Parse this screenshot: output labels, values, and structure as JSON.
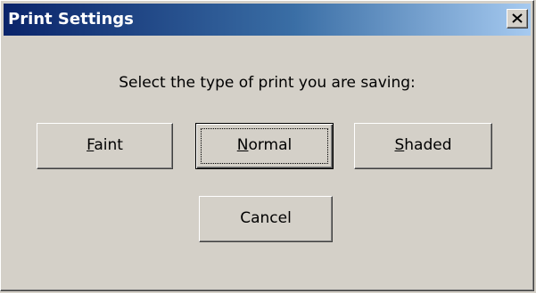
{
  "window": {
    "title": "Print Settings"
  },
  "dialog": {
    "prompt": "Select the type of print you are saving:",
    "buttons": {
      "faint": {
        "mnemonic": "F",
        "rest": "aint"
      },
      "normal": {
        "mnemonic": "N",
        "rest": "ormal"
      },
      "shaded": {
        "mnemonic": "S",
        "rest": "haded"
      },
      "cancel": "Cancel"
    },
    "default_button": "normal"
  },
  "icons": {
    "close": "close-icon"
  },
  "colors": {
    "titlebar_start": "#0a246a",
    "titlebar_end": "#a6caf0",
    "face": "#d4d0c8"
  }
}
